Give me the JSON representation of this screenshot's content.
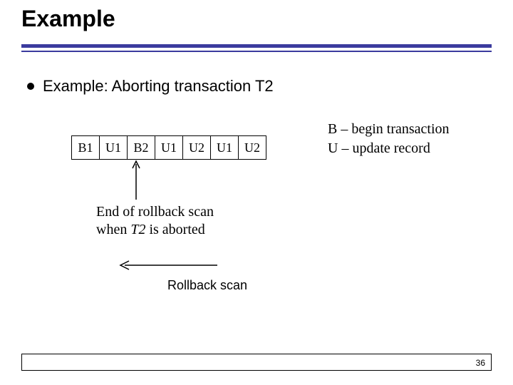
{
  "title": "Example",
  "bullet": "Example: Aborting transaction T2",
  "log_cells": [
    "B1",
    "U1",
    "B2",
    "U1",
    "U2",
    "U1",
    "U2"
  ],
  "legend": {
    "line1": "B – begin transaction",
    "line2": "U – update record"
  },
  "rollback_caption": {
    "line1_a": "End of rollback scan",
    "line2_a": "when ",
    "line2_em": "T2",
    "line2_b": " is aborted"
  },
  "rollback_scan_label": "Rollback scan",
  "page_number": "36"
}
